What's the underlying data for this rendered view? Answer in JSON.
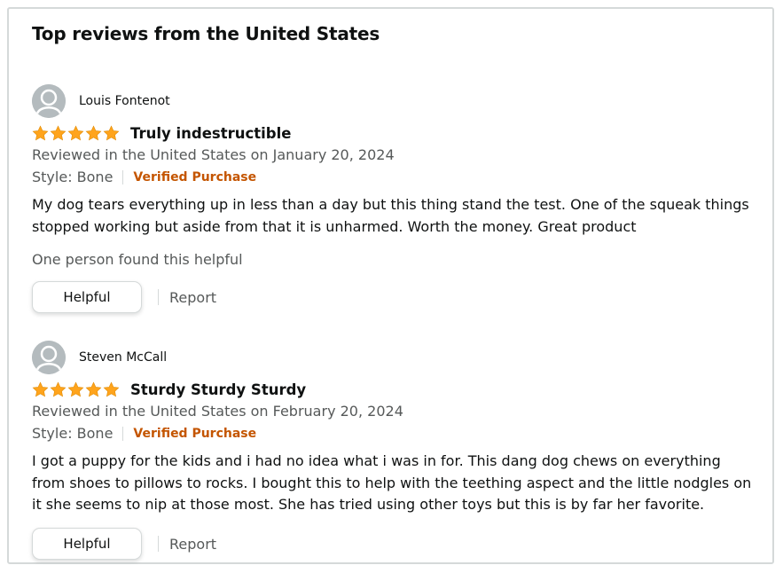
{
  "section": {
    "title": "Top reviews from the United States"
  },
  "colors": {
    "star": "#ffa41c",
    "verified": "#c45500",
    "muted": "#565959",
    "border": "#d5d9d9"
  },
  "reviews": [
    {
      "profile_name": "Louis Fontenot",
      "rating": 5,
      "title": "Truly indestructible",
      "date": "Reviewed in the United States on January 20, 2024",
      "style": "Style: Bone",
      "verified": "Verified Purchase",
      "body": "My dog tears everything up in less than a day but this thing stand the test. One of the squeak things stopped working but aside from that it is unharmed. Worth the money. Great product",
      "helpful_count_text": "One person found this helpful",
      "helpful_label": "Helpful",
      "report_label": "Report"
    },
    {
      "profile_name": "Steven McCall",
      "rating": 5,
      "title": "Sturdy Sturdy Sturdy",
      "date": "Reviewed in the United States on February 20, 2024",
      "style": "Style: Bone",
      "verified": "Verified Purchase",
      "body": "I got a puppy for the kids and i had no idea what i was in for. This dang dog chews on everything from shoes to pillows to rocks. I bought this to help with the teething aspect and the little nodgles on it she seems to nip at those most. She has tried using other toys but this is by far her favorite.",
      "helpful_label": "Helpful",
      "report_label": "Report"
    }
  ]
}
